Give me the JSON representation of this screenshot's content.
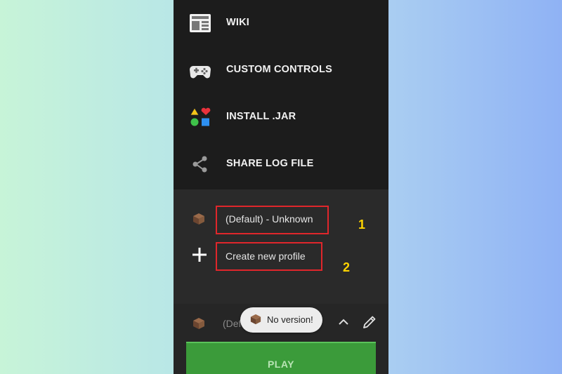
{
  "menu": {
    "items": [
      {
        "label": "WIKI",
        "icon": "newspaper-icon"
      },
      {
        "label": "CUSTOM CONTROLS",
        "icon": "gamepad-icon"
      },
      {
        "label": "INSTALL .JAR",
        "icon": "shapes-icon"
      },
      {
        "label": "SHARE LOG FILE",
        "icon": "share-icon"
      }
    ]
  },
  "profiles": {
    "default_profile": "(Default) - Unknown",
    "create_new": "Create new profile",
    "annotation_1": "1",
    "annotation_2": "2"
  },
  "bottom_bar": {
    "selected_profile_partial": "(Def",
    "toast": "No version!",
    "play_label": "PLAY"
  },
  "colors": {
    "annotation_box": "#e0262b",
    "annotation_number": "#ffd400",
    "play_button": "#3b9b3a"
  }
}
